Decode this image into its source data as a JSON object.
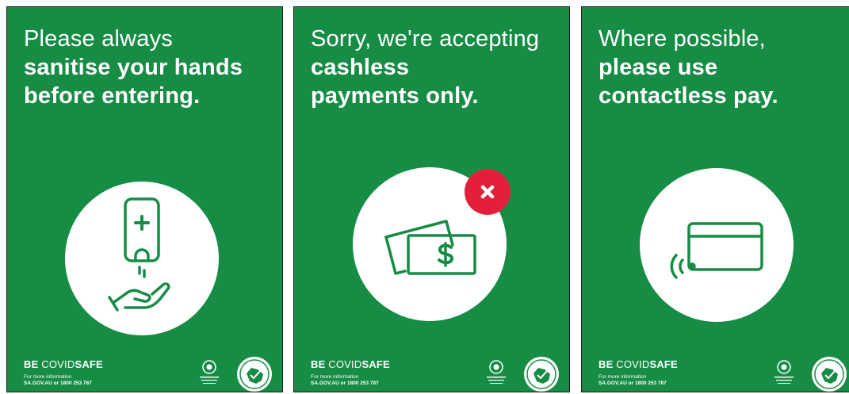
{
  "posters": [
    {
      "headline_light": "Please always",
      "headline_bold": [
        "sanitise your hands",
        "before entering."
      ],
      "icon": "hand-sanitiser-icon"
    },
    {
      "headline_light": "Sorry, we're accepting",
      "headline_bold": [
        "cashless",
        "payments only."
      ],
      "icon": "cash-notes-icon",
      "badge_icon": "close-icon"
    },
    {
      "headline_light": "Where possible,",
      "headline_bold": [
        "please use",
        "contactless pay."
      ],
      "icon": "contactless-card-icon"
    }
  ],
  "footer": {
    "brand_bold": "BE",
    "brand_regular": "COVID",
    "brand_bold_2": "SAFE",
    "info_line": "For more information",
    "contact": "SA.GOV.AU or 1800 253 787"
  },
  "colors": {
    "poster_green": "#168c45",
    "badge_red": "#e3203b",
    "white": "#ffffff"
  }
}
